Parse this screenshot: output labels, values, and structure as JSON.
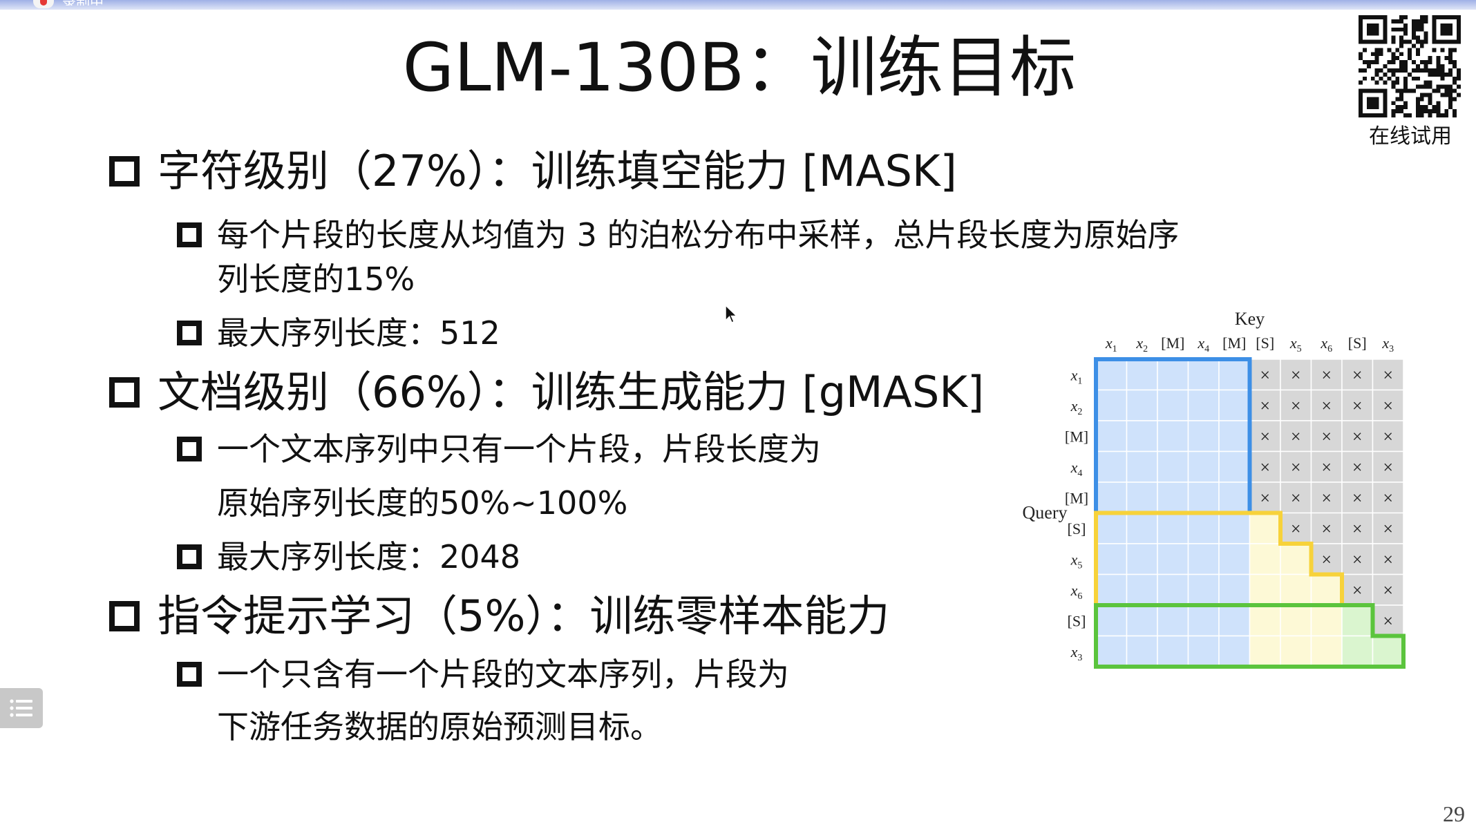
{
  "recording": {
    "label": "录制中"
  },
  "slide": {
    "title": "GLM-130B：训练目标",
    "page_number": "29"
  },
  "qr": {
    "label": "在线试用"
  },
  "bullets": {
    "b1": {
      "text": "字符级别（27%）：训练填空能力 [MASK]",
      "sub1": "每个片段的长度从均值为 3 的泊松分布中采样，总片段长度为原始序",
      "sub1_cont": "列长度的15%",
      "sub2": "最大序列长度：512"
    },
    "b2": {
      "text": "文档级别（66%）：训练生成能力 [gMASK]",
      "sub1": "一个文本序列中只有一个片段，片段长度为",
      "sub1_cont": "原始序列长度的50%~100%",
      "sub2": "最大序列长度：2048"
    },
    "b3": {
      "text": "指令提示学习（5%）：训练零样本能力",
      "sub1": "一个只含有一个片段的文本序列，片段为",
      "sub1_cont": "下游任务数据的原始预测目标。"
    }
  },
  "figure": {
    "key_label": "Key",
    "query_label": "Query",
    "tokens": [
      {
        "base": "x",
        "sub": "1"
      },
      {
        "base": "x",
        "sub": "2"
      },
      {
        "base": "[M]",
        "sub": ""
      },
      {
        "base": "x",
        "sub": "4"
      },
      {
        "base": "[M]",
        "sub": ""
      },
      {
        "base": "[S]",
        "sub": ""
      },
      {
        "base": "x",
        "sub": "5"
      },
      {
        "base": "x",
        "sub": "6"
      },
      {
        "base": "[S]",
        "sub": ""
      },
      {
        "base": "x",
        "sub": "3"
      }
    ],
    "mask_symbol": "×",
    "colors": {
      "blue_fill": "#cfe2fb",
      "blue_border": "#3d8fe6",
      "yellow_fill": "#fdf9d6",
      "yellow_border": "#f7d23a",
      "green_fill": "#daf5cf",
      "green_border": "#5bc43d",
      "masked_fill": "#d7d7d7"
    }
  }
}
